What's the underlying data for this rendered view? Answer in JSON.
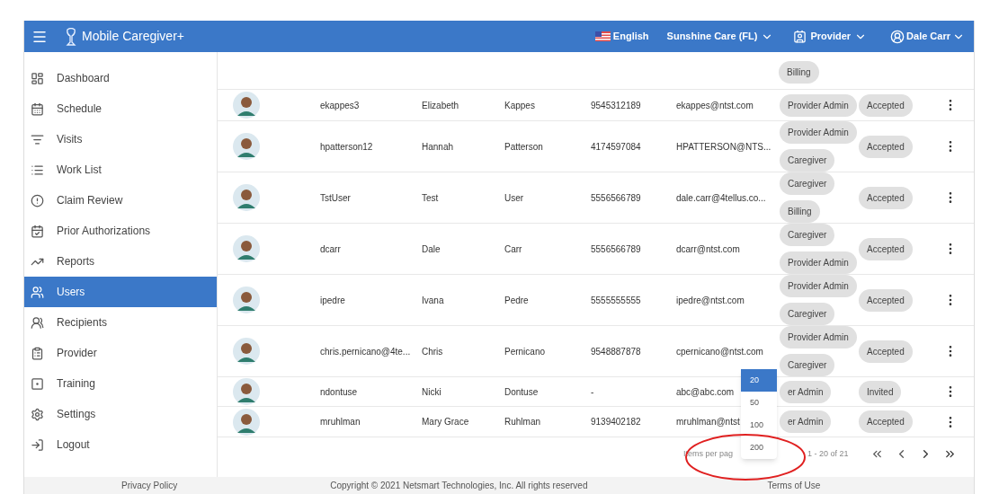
{
  "header": {
    "app_title": "Mobile Caregiver+",
    "language": "English",
    "organization": "Sunshine Care (FL)",
    "role": "Provider",
    "user": "Dale Carr"
  },
  "sidebar": {
    "items": [
      {
        "label": "Dashboard",
        "selected": false
      },
      {
        "label": "Schedule",
        "selected": false
      },
      {
        "label": "Visits",
        "selected": false
      },
      {
        "label": "Work List",
        "selected": false
      },
      {
        "label": "Claim Review",
        "selected": false
      },
      {
        "label": "Prior Authorizations",
        "selected": false
      },
      {
        "label": "Reports",
        "selected": false
      },
      {
        "label": "Users",
        "selected": true
      },
      {
        "label": "Recipients",
        "selected": false
      },
      {
        "label": "Provider",
        "selected": false
      },
      {
        "label": "Training",
        "selected": false
      },
      {
        "label": "Settings",
        "selected": false
      },
      {
        "label": "Logout",
        "selected": false
      }
    ]
  },
  "users": {
    "partial_row": {
      "roles": [
        "Billing"
      ]
    },
    "rows": [
      {
        "username": "ekappes3",
        "first_name": "Elizabeth",
        "last_name": "Kappes",
        "phone": "9545312189",
        "email": "ekappes@ntst.com",
        "roles": [
          "Provider Admin"
        ],
        "status": "Accepted"
      },
      {
        "username": "hpatterson12",
        "first_name": "Hannah",
        "last_name": "Patterson",
        "phone": "4174597084",
        "email": "HPATTERSON@NTS...",
        "roles": [
          "Provider Admin",
          "Caregiver"
        ],
        "status": "Accepted"
      },
      {
        "username": "TstUser",
        "first_name": "Test",
        "last_name": "User",
        "phone": "5556566789",
        "email": "dale.carr@4tellus.co...",
        "roles": [
          "Caregiver",
          "Billing"
        ],
        "status": "Accepted"
      },
      {
        "username": "dcarr",
        "first_name": "Dale",
        "last_name": "Carr",
        "phone": "5556566789",
        "email": "dcarr@ntst.com",
        "roles": [
          "Caregiver",
          "Provider Admin"
        ],
        "status": "Accepted"
      },
      {
        "username": "ipedre",
        "first_name": "Ivana",
        "last_name": "Pedre",
        "phone": "5555555555",
        "email": "ipedre@ntst.com",
        "roles": [
          "Provider Admin",
          "Caregiver"
        ],
        "status": "Accepted"
      },
      {
        "username": "chris.pernicano@4te...",
        "first_name": "Chris",
        "last_name": "Pernicano",
        "phone": "9548887878",
        "email": "cpernicano@ntst.com",
        "roles": [
          "Provider Admin",
          "Caregiver"
        ],
        "status": "Accepted"
      },
      {
        "username": "ndontuse",
        "first_name": "Nicki",
        "last_name": "Dontuse",
        "phone": "-",
        "email": "abc@abc.com",
        "roles": [
          "er Admin"
        ],
        "status": "Invited"
      },
      {
        "username": "mruhlman",
        "first_name": "Mary Grace",
        "last_name": "Ruhlman",
        "phone": "9139402182",
        "email": "mruhlman@ntst",
        "roles": [
          "er Admin"
        ],
        "status": "Accepted"
      }
    ],
    "pager": {
      "items_per_page_label": "Items per pag",
      "range": "1 - 20 of 21"
    },
    "page_size_menu": [
      {
        "label": "20",
        "selected": true
      },
      {
        "label": "50",
        "selected": false
      },
      {
        "label": "100",
        "selected": false
      },
      {
        "label": "200",
        "selected": false
      }
    ]
  },
  "footer": {
    "privacy": "Privacy Policy",
    "copyright": "Copyright © 2021 Netsmart Technologies, Inc. All rights reserved",
    "terms": "Terms of Use"
  }
}
